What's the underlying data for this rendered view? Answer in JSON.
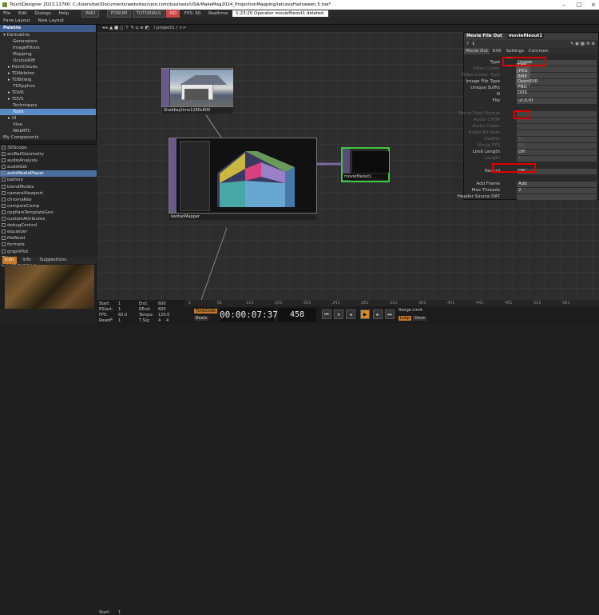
{
  "titlebar": {
    "text": "TouchDesigner 2023.11760: C:/Users/kat/Documents/websites/vjoo.com/business/USA/MakeMag2024_ProjectionMapping/latcaveHalloween.5.toe*"
  },
  "menubar": {
    "items": [
      "File",
      "Edit",
      "Dialogs",
      "Help"
    ],
    "buttons": [
      "WIKI",
      "FORUM",
      "TUTORIALS"
    ],
    "fps_badge": "OO",
    "fps": "FPS: 60",
    "realtime": "Realtime",
    "status": "1:23:20 Operator moviefileout1 deleted."
  },
  "panebar": {
    "pane_layout": "Pane Layout",
    "new_layout": "New Layout",
    "path": "/ project1 / >>"
  },
  "palette": {
    "title": "Palette",
    "items": [
      {
        "label": "Derivative",
        "indent": 0,
        "arrow": "▾"
      },
      {
        "label": "Generators",
        "indent": 2
      },
      {
        "label": "ImageFilters",
        "indent": 2
      },
      {
        "label": "Mapping",
        "indent": 2
      },
      {
        "label": "OculusRift",
        "indent": 2
      },
      {
        "label": "PointClouds",
        "indent": 1,
        "arrow": "▸"
      },
      {
        "label": "TDAbleton",
        "indent": 1,
        "arrow": "▸"
      },
      {
        "label": "TDBitwig",
        "indent": 1,
        "arrow": "▸"
      },
      {
        "label": "TDSyphon",
        "indent": 2
      },
      {
        "label": "TDVR",
        "indent": 1,
        "arrow": "▸"
      },
      {
        "label": "TDVS",
        "indent": 1,
        "arrow": "▸"
      },
      {
        "label": "Techniques",
        "indent": 2
      },
      {
        "label": "Tools",
        "indent": 2,
        "selected": true
      },
      {
        "label": "UI",
        "indent": 1,
        "arrow": "▸"
      },
      {
        "label": "Vive",
        "indent": 2
      },
      {
        "label": "WebRTC",
        "indent": 2
      },
      {
        "label": "My Components",
        "indent": 0
      }
    ]
  },
  "components": [
    "3DScope",
    "arcBallGeometry",
    "audioAnalysis",
    "audioGet",
    "autoMediaPlayer",
    "battery",
    "blendModes",
    "cameraViewport",
    "chromaKey",
    "compareComp",
    "cppParsTemplateGen",
    "customAttributes",
    "debugControl",
    "equalizer",
    "fileRead",
    "formata",
    "graphPlot",
    "histogram",
    "imageSearch"
  ],
  "selected_component": "autoMediaPlayer",
  "infotabs": [
    "Icon",
    "Info",
    "Suggestions"
  ],
  "nodes": {
    "top": "Shedbaytime1280x800",
    "mapper": "kantanMapper",
    "out": "moviefileout1"
  },
  "params": {
    "title": "Movie File Out",
    "name": "moviefileout1",
    "tabs": [
      "Movie Out",
      "EXR",
      "Settings",
      "Common"
    ],
    "rows": [
      {
        "label": "Type",
        "value": "Image"
      },
      {
        "label": "Video Codec",
        "value": "",
        "dim": true
      },
      {
        "label": "Video Codec Type",
        "value": "",
        "dim": true
      },
      {
        "label": "Image File Type",
        "value": "TIFF"
      },
      {
        "label": "Unique Suffix",
        "value": ""
      },
      {
        "label": "N",
        "value": ""
      },
      {
        "label": "File",
        "value": "ut.0.tif"
      },
      {
        "label": "",
        "value": ""
      },
      {
        "label": "Movie Pixel Format",
        "value": "",
        "dim": true
      },
      {
        "label": "Audio CHOP",
        "value": "",
        "dim": true
      },
      {
        "label": "Audio Codec",
        "value": "",
        "dim": true
      },
      {
        "label": "Audio Bit Rate",
        "value": "",
        "dim": true
      },
      {
        "label": "Quality",
        "value": "1",
        "dim": true
      },
      {
        "label": "Movie FPS",
        "value": "60",
        "dim": true
      },
      {
        "label": "Limit Length",
        "value": "Off"
      },
      {
        "label": "Length",
        "value": "1",
        "dim": true
      },
      {
        "label": "",
        "value": ""
      },
      {
        "label": "Record",
        "value": "Off"
      },
      {
        "label": "",
        "value": ""
      },
      {
        "label": "Add Frame",
        "value": "Add"
      },
      {
        "label": "Max Threads",
        "value": "2"
      },
      {
        "label": "Header Source DAT",
        "value": ""
      }
    ],
    "dropdown": [
      "TIFF",
      "JPEG",
      "BMP",
      "OpenEXR",
      "PNG",
      "DDS"
    ]
  },
  "bottom": {
    "start": "1",
    "end": "600",
    "rstart": "1",
    "rend": "600",
    "fps": "60.0",
    "tempo": "120.0",
    "resetf": "1",
    "tsig_a": "4",
    "tsig_b": "4",
    "start_label": "Start:",
    "end_label": "End:",
    "rstart_label": "RStart:",
    "rend_label": "REnd:",
    "fps_label": "FPS:",
    "tempo_label": "Tempo:",
    "resetf_label": "ResetF:",
    "tsig_label": "T Sig:",
    "timecode_btn": "TimeCode",
    "beats_btn": "Beats",
    "timecode": "00:00:07:37",
    "frame": "458",
    "range_limit": "Range Limit",
    "loop": "Loop",
    "once": "Once",
    "ruler": [
      "1",
      "81",
      "121",
      "161",
      "201",
      "241",
      "281",
      "321",
      "361",
      "401",
      "441",
      "481",
      "521",
      "561"
    ]
  }
}
